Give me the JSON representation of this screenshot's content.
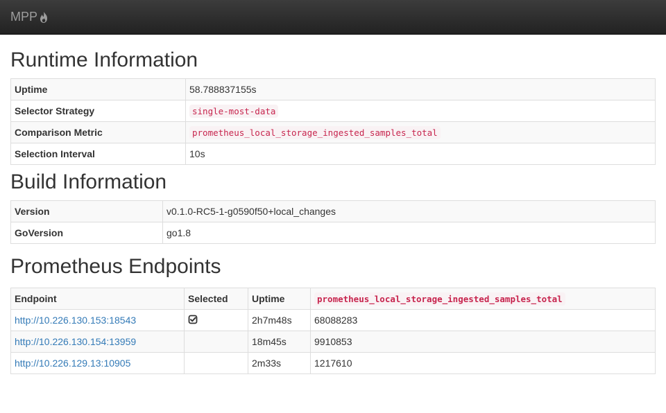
{
  "navbar": {
    "brand": "MPP",
    "brand_icon": "flame-icon"
  },
  "runtime": {
    "heading": "Runtime Information",
    "rows": [
      {
        "label": "Uptime",
        "value": "58.788837155s",
        "code": false
      },
      {
        "label": "Selector Strategy",
        "value": "single-most-data",
        "code": true
      },
      {
        "label": "Comparison Metric",
        "value": "prometheus_local_storage_ingested_samples_total",
        "code": true
      },
      {
        "label": "Selection Interval",
        "value": "10s",
        "code": false
      }
    ]
  },
  "build": {
    "heading": "Build Information",
    "rows": [
      {
        "label": "Version",
        "value": "v0.1.0-RC5-1-g0590f50+local_changes"
      },
      {
        "label": "GoVersion",
        "value": "go1.8"
      }
    ]
  },
  "endpoints": {
    "heading": "Prometheus Endpoints",
    "columns": [
      "Endpoint",
      "Selected",
      "Uptime",
      "prometheus_local_storage_ingested_samples_total"
    ],
    "rows": [
      {
        "endpoint": "http://10.226.130.153:18543",
        "selected": true,
        "uptime": "2h7m48s",
        "metric": "68088283"
      },
      {
        "endpoint": "http://10.226.130.154:13959",
        "selected": false,
        "uptime": "18m45s",
        "metric": "9910853"
      },
      {
        "endpoint": "http://10.226.129.13:10905",
        "selected": false,
        "uptime": "2m33s",
        "metric": "1217610"
      }
    ]
  },
  "colors": {
    "navbar": "#222222",
    "link": "#337ab7",
    "code_text": "#c7254e",
    "code_bg": "#f9f2f4"
  }
}
